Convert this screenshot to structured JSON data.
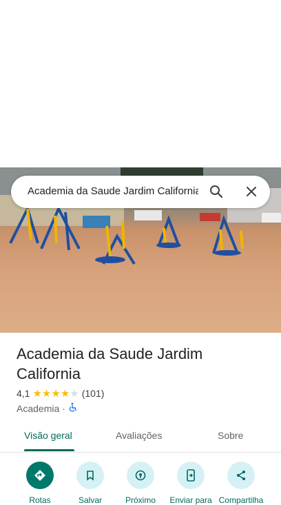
{
  "search": {
    "value": "Academia da Saude Jardim California"
  },
  "place": {
    "title": "Academia da Saude Jardim California",
    "rating": "4,1",
    "stars_filled": 4,
    "review_count": "(101)",
    "category": "Academia",
    "separator": "·"
  },
  "tabs": [
    {
      "label": "Visão geral",
      "active": true
    },
    {
      "label": "Avaliações",
      "active": false
    },
    {
      "label": "Sobre",
      "active": false
    }
  ],
  "actions": [
    {
      "label": "Rotas",
      "icon": "directions-icon"
    },
    {
      "label": "Salvar",
      "icon": "bookmark-icon"
    },
    {
      "label": "Próximo",
      "icon": "nearby-icon"
    },
    {
      "label": "Enviar para",
      "icon": "send-to-phone-icon"
    },
    {
      "label": "Compartilha",
      "icon": "share-icon"
    }
  ],
  "colors": {
    "accent": "#00695c",
    "star": "#fbbc04",
    "action_bg": "#d6f1f6",
    "primary_action_bg": "#00796b"
  }
}
